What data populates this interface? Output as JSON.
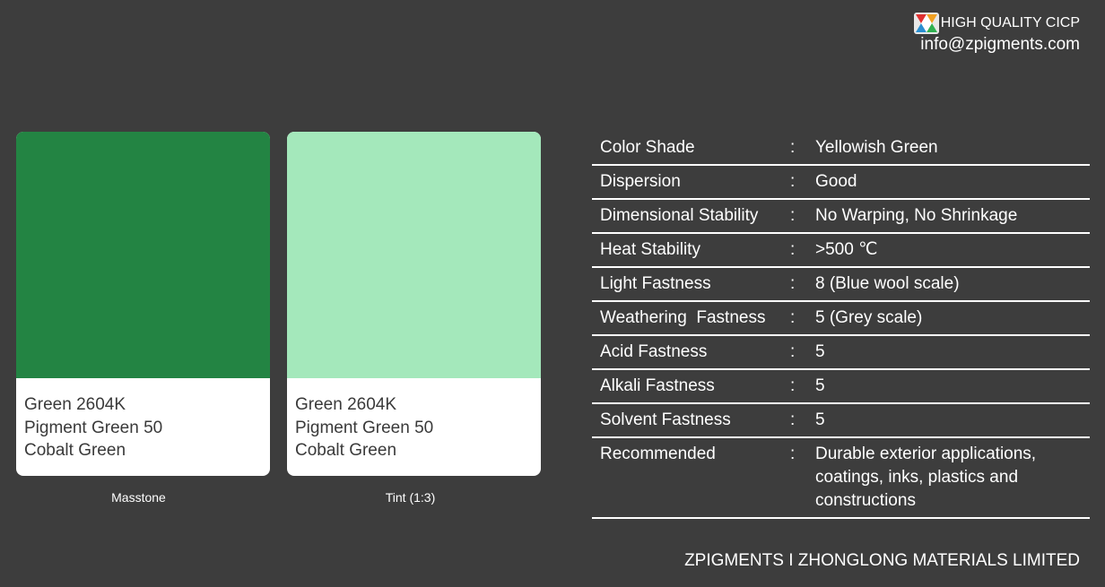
{
  "brand": {
    "logo_icon": "zpigments-logo-icon",
    "tagline": "HIGH QUALITY CICP",
    "email": "info@zpigments.com"
  },
  "cards": [
    {
      "color": "#238443",
      "lines": [
        "Green 2604K",
        "Pigment Green 50",
        "Cobalt Green"
      ],
      "caption": "Masstone"
    },
    {
      "color": "#a4e8bb",
      "lines": [
        "Green 2604K",
        "Pigment Green 50",
        "Cobalt Green"
      ],
      "caption": "Tint (1:3)"
    }
  ],
  "specs": [
    {
      "label": "Color Shade",
      "colon": ":",
      "value": "Yellowish Green"
    },
    {
      "label": "Dispersion",
      "colon": ":",
      "value": "Good"
    },
    {
      "label": "Dimensional Stability",
      "colon": ":",
      "value": "No Warping, No Shrinkage"
    },
    {
      "label": "Heat Stability",
      "colon": ":",
      "value": ">500 ℃"
    },
    {
      "label": "Light Fastness",
      "colon": ":",
      "value": "8 (Blue wool scale)"
    },
    {
      "label": "Weathering  Fastness",
      "colon": ":",
      "value": "5 (Grey scale)"
    },
    {
      "label": "Acid Fastness",
      "colon": ":",
      "value": "5"
    },
    {
      "label": "Alkali Fastness",
      "colon": ":",
      "value": "5"
    },
    {
      "label": "Solvent Fastness",
      "colon": ":",
      "value": "5"
    },
    {
      "label": "Recommended",
      "colon": ":",
      "value": "Durable exterior applications, coatings, inks, plastics and constructions"
    }
  ],
  "footer": "ZPIGMENTS I ZHONGLONG MATERIALS LIMITED"
}
